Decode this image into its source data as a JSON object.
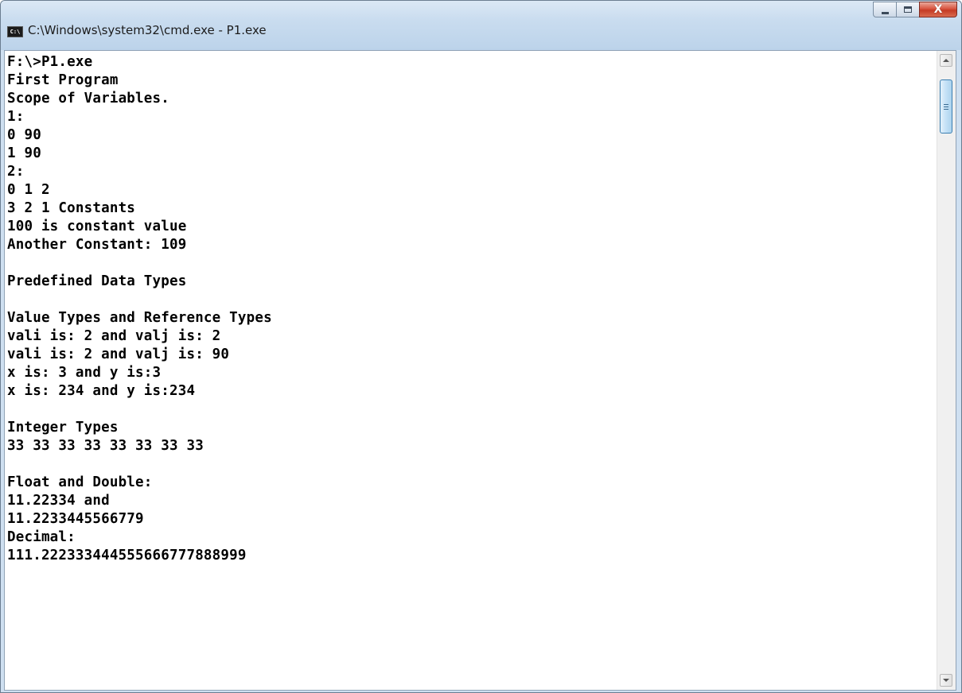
{
  "window": {
    "title": "C:\\Windows\\system32\\cmd.exe - P1.exe",
    "icon": "cmd-icon",
    "icon_text": "C:\\",
    "buttons": {
      "minimize_icon": "minimize-icon",
      "maximize_icon": "maximize-icon",
      "close_icon": "close-icon",
      "close_glyph": "X"
    }
  },
  "console": {
    "lines": [
      "F:\\>P1.exe",
      "First Program",
      "Scope of Variables.",
      "1:",
      "0 90",
      "1 90",
      "2:",
      "0 1 2",
      "3 2 1 Constants",
      "100 is constant value",
      "Another Constant: 109",
      "",
      "Predefined Data Types",
      "",
      "Value Types and Reference Types",
      "vali is: 2 and valj is: 2",
      "vali is: 2 and valj is: 90",
      "x is: 3 and y is:3",
      "x is: 234 and y is:234",
      "",
      "Integer Types",
      "33 33 33 33 33 33 33 33",
      "",
      "Float and Double:",
      "11.22334 and",
      "11.2233445566779",
      "Decimal:",
      "111.222333444555666777888999"
    ]
  },
  "scrollbar": {
    "up_icon": "scroll-up-arrow-icon",
    "down_icon": "scroll-down-arrow-icon",
    "position": 0.02
  },
  "colors": {
    "console_bg": "#ffffff",
    "console_text": "#000000",
    "titlebar": "#c9dcef",
    "close_button": "#c94a32"
  }
}
